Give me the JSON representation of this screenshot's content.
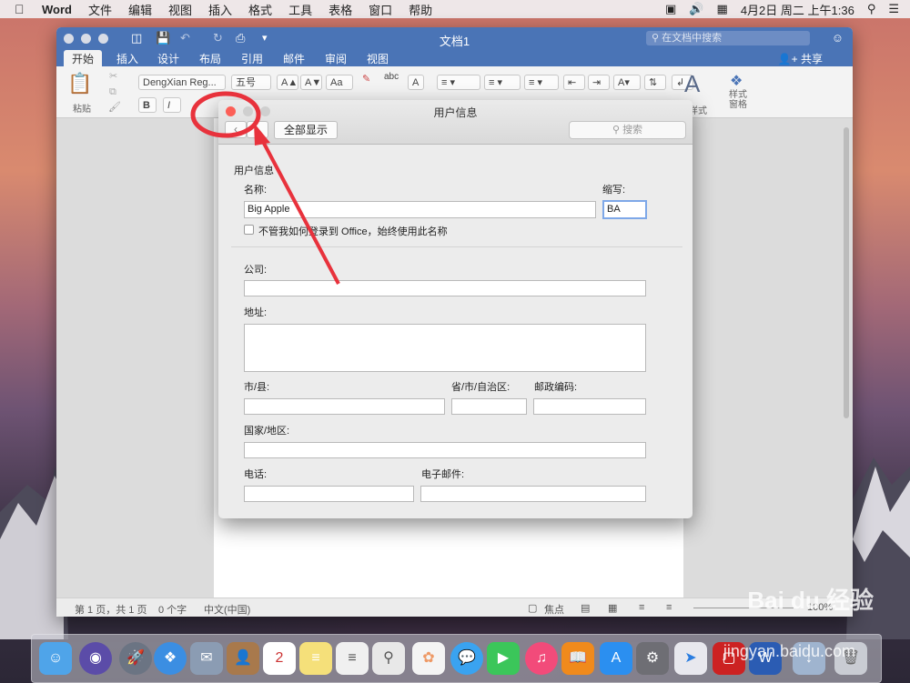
{
  "menubar": {
    "app_name": "Word",
    "items": [
      "文件",
      "编辑",
      "视图",
      "插入",
      "格式",
      "工具",
      "表格",
      "窗口",
      "帮助"
    ],
    "clock": "4月2日 周二 上午1:36"
  },
  "word": {
    "title": "文档1",
    "search_placeholder": "在文档中搜索",
    "tabs": [
      "开始",
      "插入",
      "设计",
      "布局",
      "引用",
      "邮件",
      "审阅",
      "视图"
    ],
    "share": "共享",
    "paste": "粘贴",
    "font_name": "DengXian Reg...",
    "font_size": "五号",
    "styles_label": "样式",
    "styles_pane": "样式\n窗格",
    "status": {
      "page": "第 1 页，共 1 页",
      "words": "0 个字",
      "lang": "中文(中国)",
      "focus": "焦点",
      "zoom": "100%"
    }
  },
  "dialog": {
    "title": "用户信息",
    "show_all": "全部显示",
    "search_placeholder": "搜索",
    "section": "用户信息",
    "name_label": "名称:",
    "name_value": "Big Apple",
    "abbr_label": "缩写:",
    "abbr_value": "BA",
    "always_use": "不管我如何登录到 Office，始终使用此名称",
    "company_label": "公司:",
    "address_label": "地址:",
    "city_label": "市/县:",
    "province_label": "省/市/自治区:",
    "zip_label": "邮政编码:",
    "country_label": "国家/地区:",
    "phone_label": "电话:",
    "email_label": "电子邮件:"
  },
  "watermark": {
    "brand": "Bai du 经验",
    "url": "jingyan.baidu.com"
  },
  "colors": {
    "title_blue": "#4a74b6",
    "annotation_red": "#e8323c"
  }
}
